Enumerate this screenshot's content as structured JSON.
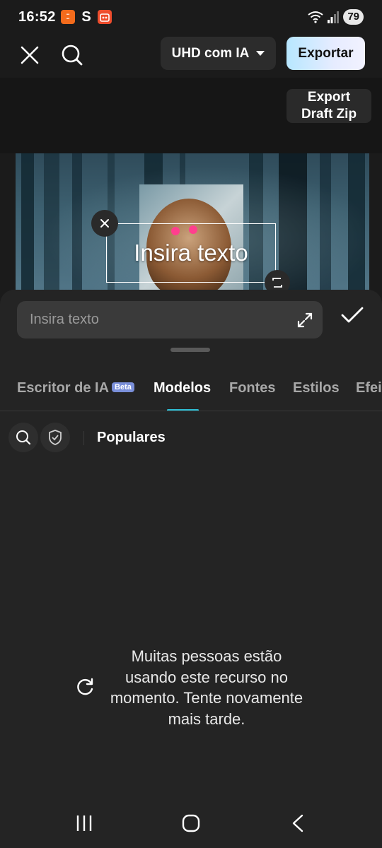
{
  "status_bar": {
    "time": "16:52",
    "notifications": [
      "temu-icon",
      "s-icon",
      "shop-icon"
    ],
    "battery": "79"
  },
  "toolbar": {
    "quality_label": "UHD com IA",
    "export_label": "Exportar",
    "export_draft_label_line1": "Export",
    "export_draft_label_line2": "Draft Zip"
  },
  "canvas": {
    "overlay_text": "Insira texto"
  },
  "editor": {
    "input_placeholder": "Insira texto",
    "input_value": ""
  },
  "tabs": [
    {
      "label": "Escritor de IA",
      "badge": "Beta"
    },
    {
      "label": "Modelos"
    },
    {
      "label": "Fontes"
    },
    {
      "label": "Estilos"
    },
    {
      "label": "Efei"
    }
  ],
  "active_tab": "Modelos",
  "filters": {
    "category": "Populares"
  },
  "error": {
    "message": "Muitas pessoas estão usando este recurso no momento. Tente novamente mais tarde."
  },
  "colors": {
    "accent": "#2fc0d6",
    "background": "#242424",
    "export_gradient_start": "#b7e7ff"
  }
}
